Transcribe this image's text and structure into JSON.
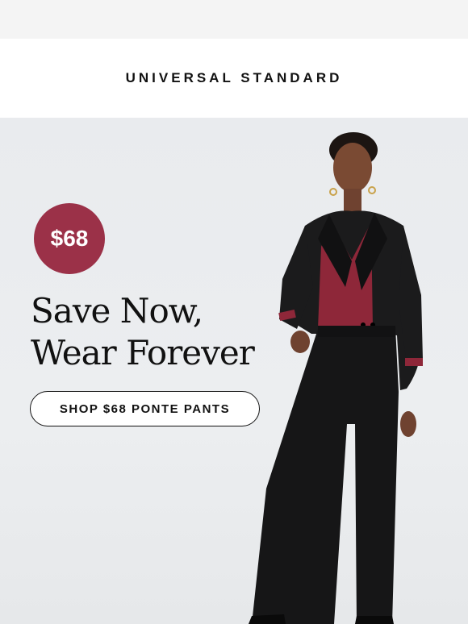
{
  "header": {
    "brand": "UNIVERSAL STANDARD"
  },
  "hero": {
    "price": "$68",
    "headline_line1": "Save Now,",
    "headline_line2": "Wear Forever",
    "cta_label": "SHOP $68 PONTE PANTS"
  },
  "colors": {
    "badge": "#9b3148",
    "text": "#111111",
    "hero_background": "#eaecee"
  }
}
